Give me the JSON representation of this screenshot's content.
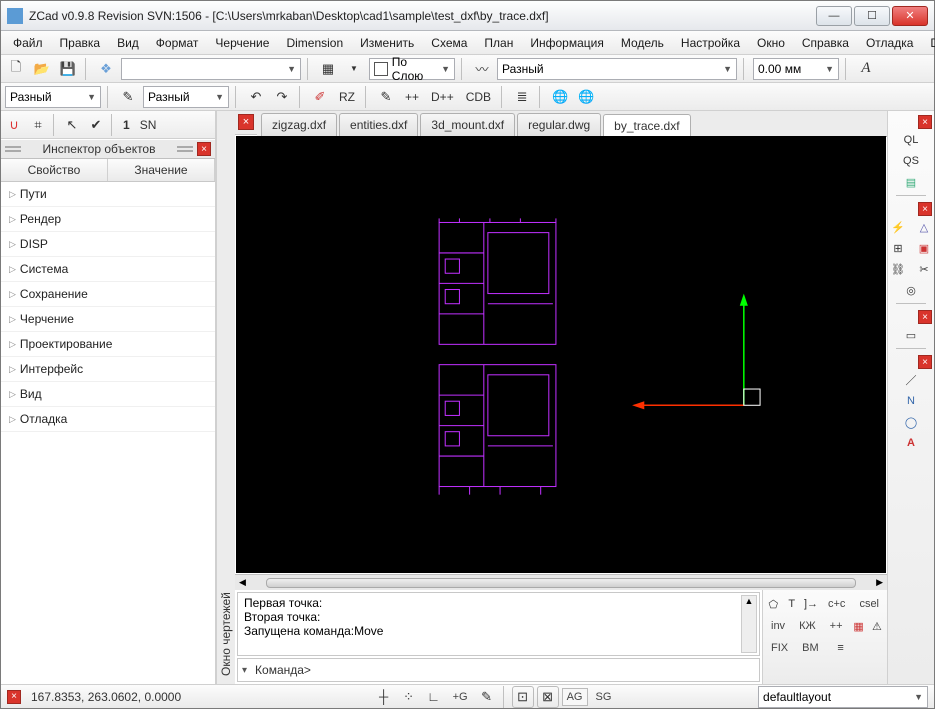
{
  "title": "ZCad v0.9.8 Revision SVN:1506 - [C:\\Users\\mrkaban\\Desktop\\cad1\\sample\\test_dxf\\by_trace.dxf]",
  "menu": [
    "Файл",
    "Правка",
    "Вид",
    "Формат",
    "Черчение",
    "Dimension",
    "Изменить",
    "Схема",
    "План",
    "Информация",
    "Модель",
    "Настройка",
    "Окно",
    "Справка",
    "Отладка",
    "DB"
  ],
  "toolbar1": {
    "layer_combo": "",
    "color_swatch": "#ffffff",
    "color_label": "По Слою",
    "linetype_label": "Разный",
    "lineweight_value": "0.00 мм"
  },
  "toolbar2": {
    "combo1": "Разный",
    "combo2": "Разный",
    "btns": [
      "RZ",
      "++",
      "D++",
      "CDB"
    ]
  },
  "left_toolbar": {
    "num": "1",
    "sn": "SN"
  },
  "inspector": {
    "title": "Инспектор объектов",
    "col1": "Свойство",
    "col2": "Значение",
    "items": [
      "Пути",
      "Рендер",
      "DISP",
      "Система",
      "Сохранение",
      "Черчение",
      "Проектирование",
      "Интерфейс",
      "Вид",
      "Отладка"
    ]
  },
  "vtab": "Окно чертежей",
  "tabs": [
    "zigzag.dxf",
    "entities.dxf",
    "3d_mount.dxf",
    "regular.dwg",
    "by_trace.dxf"
  ],
  "active_tab": 4,
  "log": {
    "l1": "Первая точка:",
    "l2": "Вторая точка:",
    "l3": "Запущена команда:Move"
  },
  "prompt": "Команда>",
  "rightcol": {
    "ql": "QL",
    "qs": "QS"
  },
  "right_status": {
    "r1": [
      "c+c",
      "csel"
    ],
    "r2": [
      "inv",
      "КЖ",
      "++"
    ],
    "r3": [
      "FIX",
      "BM"
    ]
  },
  "status": {
    "coords": "167.8353, 263.0602, 0.0000",
    "g": "+G",
    "ag": "AG",
    "sg": "SG",
    "layout": "defaultlayout"
  }
}
